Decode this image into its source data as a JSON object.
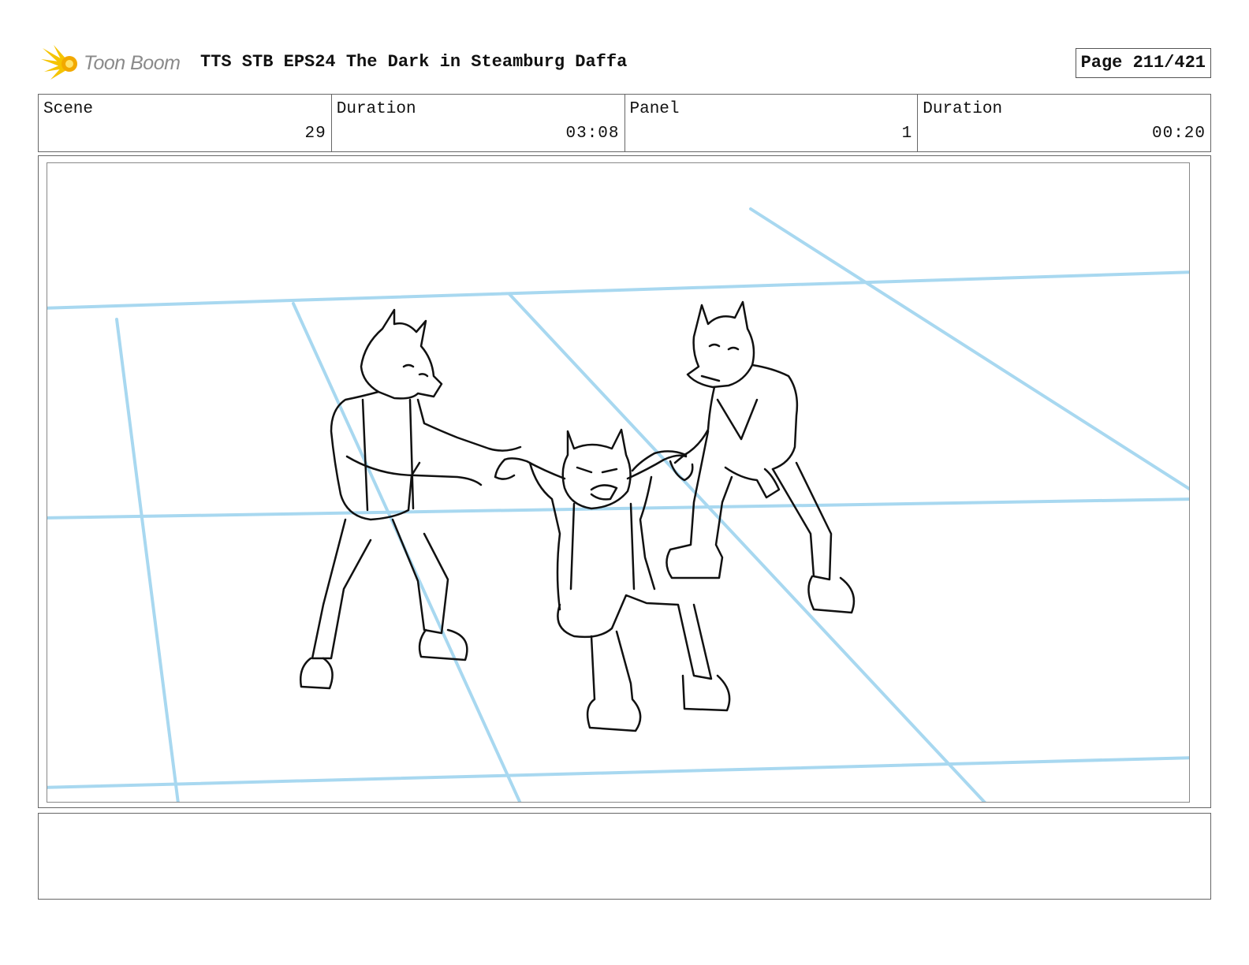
{
  "header": {
    "logo_text": "Toon Boom",
    "title": "TTS STB EPS24 The Dark in Steamburg Daffa",
    "page_label": "Page 211/421"
  },
  "info": {
    "scene_label": "Scene",
    "scene_value": "29",
    "scene_duration_label": "Duration",
    "scene_duration_value": "03:08",
    "panel_label": "Panel",
    "panel_value": "1",
    "panel_duration_label": "Duration",
    "panel_duration_value": "00:20"
  },
  "panel": {
    "image_icon": "storyboard-sketch-image",
    "guide_color": "#a8d8f0",
    "sketch_color": "#111111"
  },
  "notes": {
    "text": ""
  }
}
